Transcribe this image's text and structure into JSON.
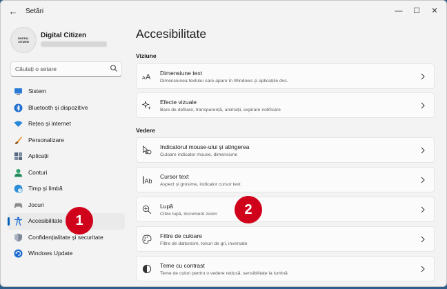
{
  "window": {
    "title": "Setări"
  },
  "profile": {
    "avatar_text": "DIGITAL CITIZEN",
    "name": "Digital Citizen"
  },
  "search": {
    "placeholder": "Căutați o setare"
  },
  "sidebar": {
    "items": [
      {
        "label": "Sistem",
        "icon": "monitor-icon"
      },
      {
        "label": "Bluetooth și dispozitive",
        "icon": "bluetooth-icon"
      },
      {
        "label": "Rețea și internet",
        "icon": "wifi-icon"
      },
      {
        "label": "Personalizare",
        "icon": "brush-icon"
      },
      {
        "label": "Aplicații",
        "icon": "apps-icon"
      },
      {
        "label": "Conturi",
        "icon": "person-icon"
      },
      {
        "label": "Timp și limbă",
        "icon": "globe-clock-icon"
      },
      {
        "label": "Jocuri",
        "icon": "gamepad-icon"
      },
      {
        "label": "Accesibilitate",
        "icon": "accessibility-icon",
        "active": true
      },
      {
        "label": "Confidențialitate și securitate",
        "icon": "shield-icon"
      },
      {
        "label": "Windows Update",
        "icon": "update-icon"
      }
    ]
  },
  "main": {
    "title": "Accesibilitate",
    "sections": [
      {
        "title": "Viziune",
        "cards": [
          {
            "title": "Dimensiune text",
            "subtitle": "Dimensiunea textului care apare în Windows și aplicațiile dvs.",
            "icon": "text-size-icon"
          },
          {
            "title": "Efecte vizuale",
            "subtitle": "Bare de defilare, transparență, animații, expirare notificare",
            "icon": "sparkle-icon"
          }
        ]
      },
      {
        "title": "Vedere",
        "cards": [
          {
            "title": "Indicatorul mouse-ului și atingerea",
            "subtitle": "Culoare indicator mouse, dimensiune",
            "icon": "mouse-pointer-icon"
          },
          {
            "title": "Cursor text",
            "subtitle": "Aspect și grosime, indicator cursor text",
            "icon": "text-cursor-icon"
          },
          {
            "title": "Lupă",
            "subtitle": "Citire lupă, increment zoom",
            "icon": "magnifier-icon"
          },
          {
            "title": "Filtre de culoare",
            "subtitle": "Filtre de daltonism, tonuri de gri, inversate",
            "icon": "palette-icon"
          },
          {
            "title": "Teme cu contrast",
            "subtitle": "Teme de culori pentru o vedere redusă, sensibilitate la lumină",
            "icon": "contrast-icon"
          }
        ]
      }
    ]
  },
  "callouts": [
    "1",
    "2"
  ],
  "colors": {
    "accent": "#005fb8",
    "callout": "#d0021b",
    "background": "#f3f3f3",
    "card": "#fbfbfb"
  }
}
